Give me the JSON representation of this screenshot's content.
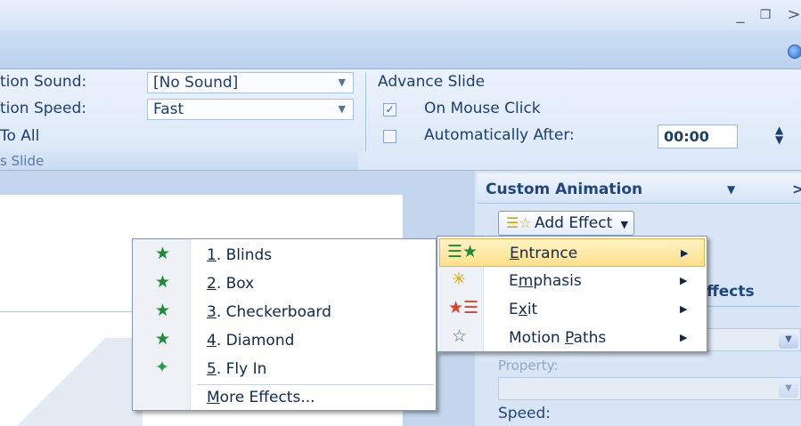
{
  "window": {
    "minimize_glyph": "_",
    "restore_glyph": "❐",
    "close_glyph": ">"
  },
  "ribbon": {
    "transition_sound_label": "tion Sound:",
    "transition_sound_value": "[No Sound]",
    "transition_speed_label": "tion Speed:",
    "transition_speed_value": "Fast",
    "apply_to_all": "To All",
    "group_label": "s Slide",
    "advance_title": "Advance Slide",
    "on_mouse_click": "On Mouse Click",
    "on_mouse_click_checked": true,
    "auto_after": "Automatically After:",
    "auto_after_checked": false,
    "auto_time": "00:00"
  },
  "pane": {
    "title": "Custom Animation",
    "add_effect": "Add Effect",
    "effects_partial": "ffects",
    "property_label": "Property:",
    "speed_label": "Speed:"
  },
  "add_effect_menu": {
    "items": [
      {
        "label": "Entrance",
        "underline": "E",
        "icon": "entrance-star-icon",
        "highlighted": true
      },
      {
        "label": "Emphasis",
        "underline": "m",
        "icon": "emphasis-star-icon",
        "highlighted": false
      },
      {
        "label": "Exit",
        "underline": "x",
        "icon": "exit-star-icon",
        "highlighted": false
      },
      {
        "label": "Motion Paths",
        "underline": "P",
        "icon": "motion-path-star-icon",
        "highlighted": false
      }
    ]
  },
  "entrance_submenu": {
    "items": [
      {
        "num": "1",
        "label": ". Blinds",
        "icon": "blinds-star-icon"
      },
      {
        "num": "2",
        "label": ". Box",
        "icon": "box-star-icon"
      },
      {
        "num": "3",
        "label": ". Checkerboard",
        "icon": "checkerboard-star-icon"
      },
      {
        "num": "4",
        "label": ". Diamond",
        "icon": "diamond-star-icon"
      },
      {
        "num": "5",
        "label": ". Fly In",
        "icon": "fly-in-star-icon"
      }
    ],
    "more_underline": "M",
    "more_rest": "ore Effects..."
  },
  "colors": {
    "ribbon_bg": "#dbe8f7",
    "menu_highlight": "#ffe08a",
    "text_primary": "#1d3e70"
  }
}
